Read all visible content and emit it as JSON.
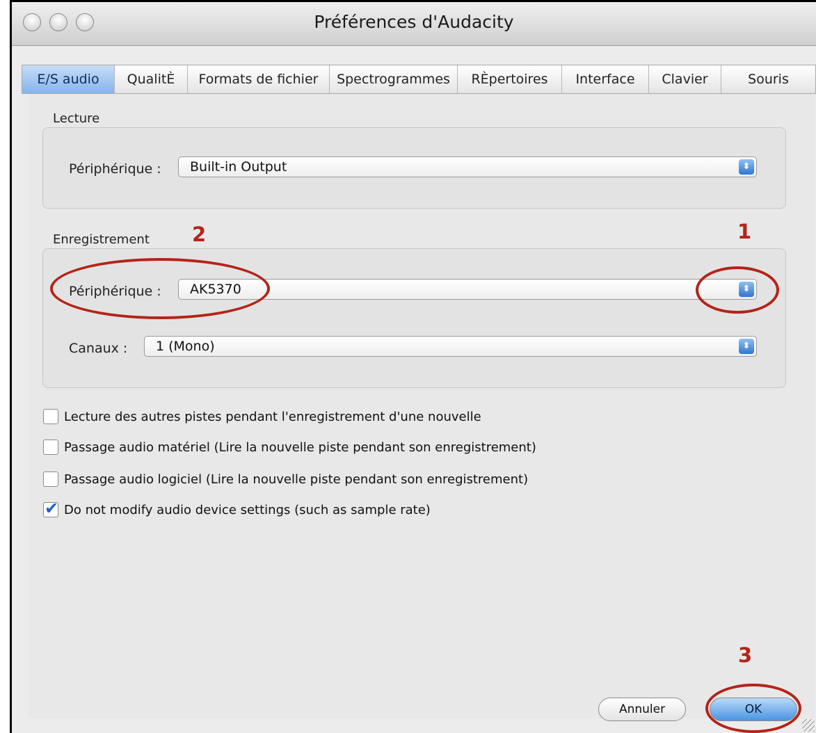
{
  "window": {
    "title": "Préférences d'Audacity"
  },
  "tabs": [
    {
      "label": "E/S audio",
      "active": true
    },
    {
      "label": "QualitÈ"
    },
    {
      "label": "Formats de fichier"
    },
    {
      "label": "Spectrogrammes"
    },
    {
      "label": "RÈpertoires"
    },
    {
      "label": "Interface"
    },
    {
      "label": "Clavier"
    },
    {
      "label": "Souris"
    }
  ],
  "playback": {
    "section_label": "Lecture",
    "device_label": "Périphérique :",
    "device_value": "Built-in Output"
  },
  "recording": {
    "section_label": "Enregistrement",
    "device_label": "Périphérique :",
    "device_value": "AK5370",
    "channels_label": "Canaux :",
    "channels_value": "1 (Mono)"
  },
  "options": [
    {
      "label": "Lecture des autres pistes pendant l'enregistrement d'une nouvelle",
      "checked": false
    },
    {
      "label": "Passage audio matériel (Lire la nouvelle piste pendant son enregistrement)",
      "checked": false
    },
    {
      "label": "Passage audio logiciel (Lire la nouvelle piste pendant son enregistrement)",
      "checked": false
    },
    {
      "label": "Do not modify audio device settings (such as sample rate)",
      "checked": true
    }
  ],
  "buttons": {
    "cancel_label": "Annuler",
    "ok_label": "OK"
  },
  "annotations": {
    "n1": "1",
    "n2": "2",
    "n3": "3",
    "color": "#b32418"
  }
}
